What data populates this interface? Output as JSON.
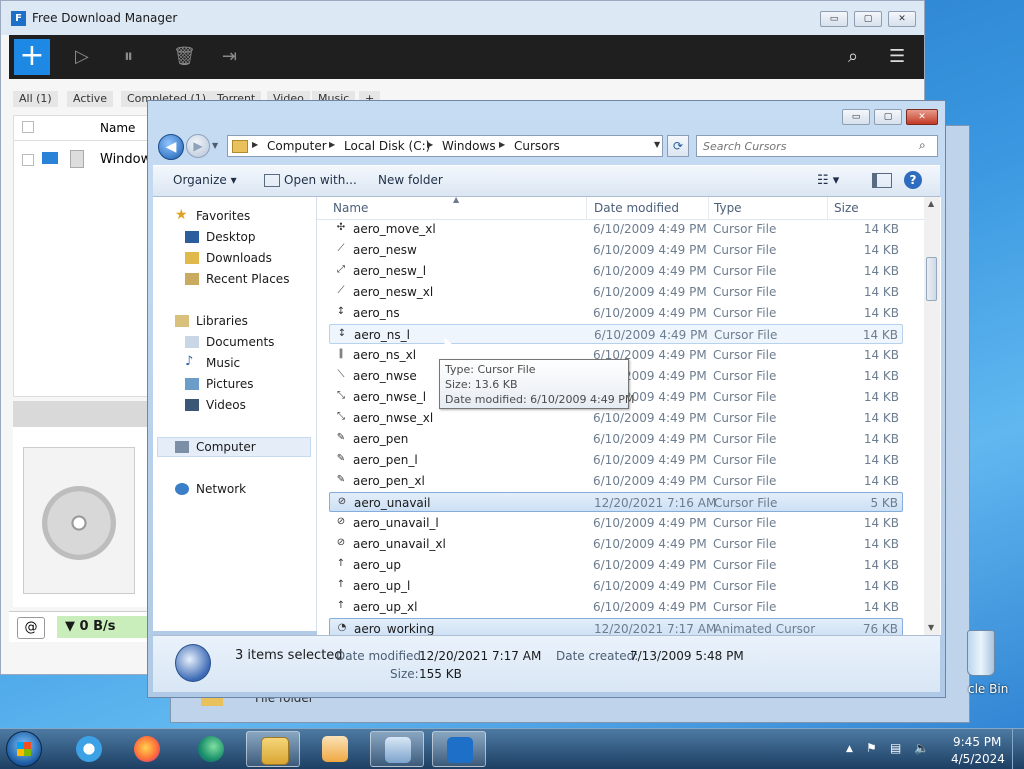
{
  "fdm": {
    "title": "Free Download Manager",
    "window_controls": {
      "minimize": "▭",
      "restore": "▢",
      "close": "✕"
    },
    "add_label": "+",
    "tabs": [
      "All (1)",
      "Active",
      "Completed (1)",
      "Torrent",
      "Video",
      "Music",
      "+"
    ],
    "list_header_name": "Name",
    "list_item_name": "Window",
    "speed": "▼ 0 B/s"
  },
  "explorer": {
    "window_controls": {
      "minimize": "▭",
      "restore": "▢",
      "close": "✕"
    },
    "address": {
      "crumbs": [
        "Computer",
        "Local Disk (C:)",
        "Windows",
        "Cursors"
      ]
    },
    "search_placeholder": "Search Cursors",
    "toolbar": {
      "organize": "Organize ▾",
      "open_with": "Open with...",
      "new_folder": "New folder"
    },
    "nav": {
      "favorites": "Favorites",
      "desktop": "Desktop",
      "downloads": "Downloads",
      "recent_places": "Recent Places",
      "libraries": "Libraries",
      "documents": "Documents",
      "music": "Music",
      "pictures": "Pictures",
      "videos": "Videos",
      "computer": "Computer",
      "network": "Network"
    },
    "columns": {
      "name": "Name",
      "date": "Date modified",
      "type": "Type",
      "size": "Size"
    },
    "files": [
      {
        "name": "aero_move_xl",
        "date": "6/10/2009 4:49 PM",
        "type": "Cursor File",
        "size": "14 KB",
        "icon": "✣"
      },
      {
        "name": "aero_nesw",
        "date": "6/10/2009 4:49 PM",
        "type": "Cursor File",
        "size": "14 KB",
        "icon": "⟋"
      },
      {
        "name": "aero_nesw_l",
        "date": "6/10/2009 4:49 PM",
        "type": "Cursor File",
        "size": "14 KB",
        "icon": "⤢"
      },
      {
        "name": "aero_nesw_xl",
        "date": "6/10/2009 4:49 PM",
        "type": "Cursor File",
        "size": "14 KB",
        "icon": "⟋"
      },
      {
        "name": "aero_ns",
        "date": "6/10/2009 4:49 PM",
        "type": "Cursor File",
        "size": "14 KB",
        "icon": "↕"
      },
      {
        "name": "aero_ns_l",
        "date": "6/10/2009 4:49 PM",
        "type": "Cursor File",
        "size": "14 KB",
        "icon": "↕"
      },
      {
        "name": "aero_ns_xl",
        "date": "6/10/2009 4:49 PM",
        "type": "Cursor File",
        "size": "14 KB",
        "icon": "‖"
      },
      {
        "name": "aero_nwse",
        "date": "6/10/2009 4:49 PM",
        "type": "Cursor File",
        "size": "14 KB",
        "icon": "⟍"
      },
      {
        "name": "aero_nwse_l",
        "date": "6/10/2009 4:49 PM",
        "type": "Cursor File",
        "size": "14 KB",
        "icon": "⤡"
      },
      {
        "name": "aero_nwse_xl",
        "date": "6/10/2009 4:49 PM",
        "type": "Cursor File",
        "size": "14 KB",
        "icon": "⤡"
      },
      {
        "name": "aero_pen",
        "date": "6/10/2009 4:49 PM",
        "type": "Cursor File",
        "size": "14 KB",
        "icon": "✎"
      },
      {
        "name": "aero_pen_l",
        "date": "6/10/2009 4:49 PM",
        "type": "Cursor File",
        "size": "14 KB",
        "icon": "✎"
      },
      {
        "name": "aero_pen_xl",
        "date": "6/10/2009 4:49 PM",
        "type": "Cursor File",
        "size": "14 KB",
        "icon": "✎"
      },
      {
        "name": "aero_unavail",
        "date": "12/20/2021 7:16 AM",
        "type": "Cursor File",
        "size": "5 KB",
        "icon": "⊘"
      },
      {
        "name": "aero_unavail_l",
        "date": "6/10/2009 4:49 PM",
        "type": "Cursor File",
        "size": "14 KB",
        "icon": "⊘"
      },
      {
        "name": "aero_unavail_xl",
        "date": "6/10/2009 4:49 PM",
        "type": "Cursor File",
        "size": "14 KB",
        "icon": "⊘"
      },
      {
        "name": "aero_up",
        "date": "6/10/2009 4:49 PM",
        "type": "Cursor File",
        "size": "14 KB",
        "icon": "↑"
      },
      {
        "name": "aero_up_l",
        "date": "6/10/2009 4:49 PM",
        "type": "Cursor File",
        "size": "14 KB",
        "icon": "↑"
      },
      {
        "name": "aero_up_xl",
        "date": "6/10/2009 4:49 PM",
        "type": "Cursor File",
        "size": "14 KB",
        "icon": "↑"
      },
      {
        "name": "aero_working",
        "date": "12/20/2021 7:17 AM",
        "type": "Animated Cursor",
        "size": "76 KB",
        "icon": "◔"
      }
    ],
    "selected_rows": [
      13,
      19
    ],
    "hover_row": 5,
    "tooltip": {
      "type": "Type: Cursor File",
      "size": "Size: 13.6 KB",
      "date": "Date modified: 6/10/2009 4:49 PM"
    },
    "details": {
      "count": "3 items selected",
      "date_modified_label": "Date modified:",
      "date_modified_value": "12/20/2021 7:17 AM",
      "date_created_label": "Date created:",
      "date_created_value": "7/13/2009 5:48 PM",
      "size_label": "Size:",
      "size_value": "155 KB"
    }
  },
  "desktop": {
    "recycle_bin_label": "cle Bin",
    "behind_label": "File folder"
  },
  "taskbar": {
    "time": "9:45 PM",
    "date": "4/5/2024",
    "apps": [
      "internet-explorer",
      "firefox",
      "edge",
      "file-explorer",
      "media-player",
      "control-panel",
      "free-download-manager"
    ]
  },
  "colors": {
    "accent": "#1e88e5",
    "selection": "#cde0f5",
    "speed_bg": "#c9eebb"
  }
}
